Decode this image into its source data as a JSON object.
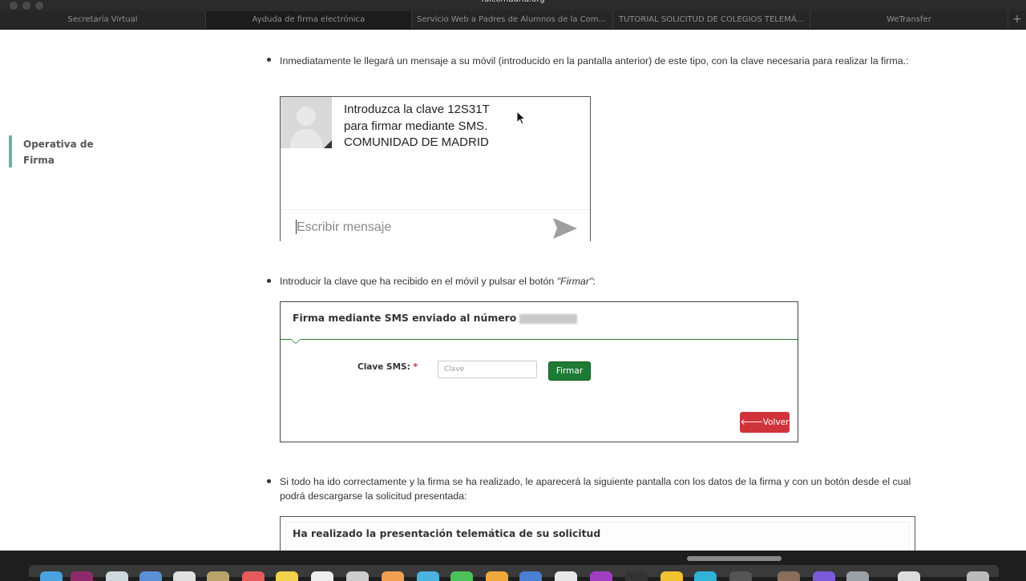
{
  "browser": {
    "url": "fulcomadrid.org",
    "tabs": [
      {
        "label": "Secretaría Virtual",
        "active": false
      },
      {
        "label": "Ayduda de firma electrónica",
        "active": true
      },
      {
        "label": "Servicio Web a Padres de Alumnos de la Comu...",
        "active": false
      },
      {
        "label": "TUTORIAL SOLICITUD DE COLEGIOS TELEMÁ...",
        "active": false
      },
      {
        "label": "WeTransfer",
        "active": false
      }
    ],
    "new_tab": "+"
  },
  "sidebar": {
    "item": "Operativa de Firma"
  },
  "content": {
    "step1": "Inmediatamente le llegará un mensaje a su móvil (introducido en la pantalla anterior) de este tipo, con la clave necesaria para realizar la firma.:",
    "sms": {
      "line1": "Introduzca la clave 12S31T",
      "line2": "para firmar mediante SMS.",
      "line3": "COMUNIDAD DE MADRID",
      "input_placeholder": "Escribir mensaje"
    },
    "step2_text": "Introducir la clave que ha recibido en el móvil y pulsar el botón ",
    "step2_emph": "\"Firmar\"",
    "step2_end": ":",
    "firma_panel": {
      "title": "Firma mediante SMS enviado al número",
      "clave_label": "Clave SMS:",
      "required_mark": "*",
      "clave_placeholder": "Clave",
      "firmar_button": "Firmar",
      "volver_button": "Volver"
    },
    "step3": "Si todo ha ido correctamente y la firma se ha realizado, le aparecerá la siguiente pantalla con los datos de la firma y con un botón desde el cual podrá descargarse la solicitud presentada:",
    "confirm_panel": {
      "title": "Ha realizado la presentación telemática de su solicitud"
    }
  },
  "colors": {
    "accent_teal": "#5fb6a5",
    "firmar_green": "#1e7b34",
    "volver_red": "#d0343b"
  }
}
